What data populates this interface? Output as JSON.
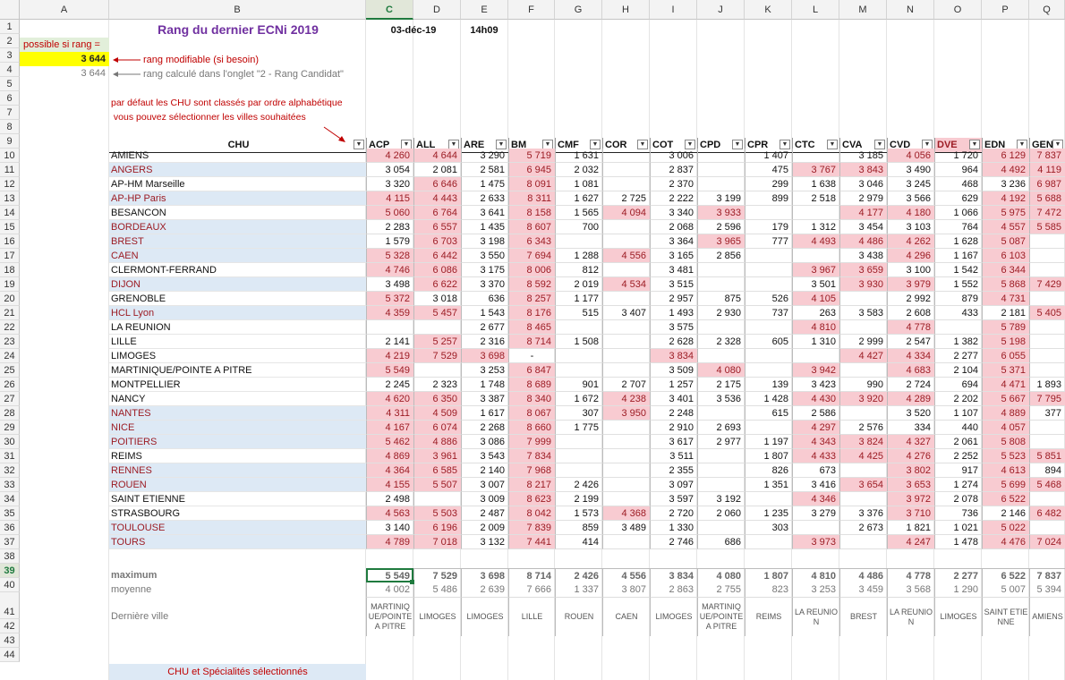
{
  "columns": [
    "A",
    "B",
    "C",
    "D",
    "E",
    "F",
    "G",
    "H",
    "I",
    "J",
    "K",
    "L",
    "M",
    "N",
    "O",
    "P",
    "Q"
  ],
  "selected_column": "C",
  "selected_row": "39",
  "row_numbers": [
    "1",
    "2",
    "3",
    "4",
    "5",
    "6",
    "7",
    "8",
    "9",
    "10",
    "11",
    "12",
    "13",
    "14",
    "15",
    "16",
    "17",
    "18",
    "19",
    "20",
    "21",
    "22",
    "23",
    "24",
    "25",
    "26",
    "27",
    "28",
    "29",
    "30",
    "31",
    "32",
    "33",
    "34",
    "35",
    "36",
    "37",
    "38",
    "39",
    "40",
    "41",
    "42",
    "43",
    "44"
  ],
  "header": {
    "title": "Rang du dernier ECNi 2019",
    "date": "03-déc-19",
    "time": "14h09"
  },
  "rank_panel": {
    "possible_label": "possible si rang =",
    "rank_value": "3 644",
    "rank_calc_value": "3 644",
    "note_modifiable": "rang modifiable (si besoin)",
    "note_calc": "rang calculé dans l'onglet \"2 - Rang Candidat\""
  },
  "instructions": [
    "par défaut les CHU sont classés par ordre alphabétique",
    " vous pouvez sélectionner les villes souhaitées"
  ],
  "colors": {
    "pink_fill": "#f8cbd1",
    "pink_text": "#9c1c24",
    "highlight_row": "#dde9f5",
    "title_purple": "#7030a0",
    "yellow": "#ffff00",
    "arrow_red": "#c00000"
  },
  "table": {
    "chu_header": "CHU",
    "specialties": [
      "ACP",
      "ALL",
      "ARE",
      "BM",
      "CMF",
      "COR",
      "COT",
      "CPD",
      "CPR",
      "CTC",
      "CVA",
      "CVD",
      "DVE",
      "EDN",
      "GEN"
    ],
    "rows": [
      {
        "chu": "AMIENS",
        "hl": false,
        "values": [
          "4 260",
          "4 644",
          "3 290",
          "5 719",
          "1 631",
          "",
          "3 006",
          "",
          "1 407",
          "",
          "3 185",
          "4 056",
          "1 720",
          "6 129",
          "7 837"
        ],
        "pink": [
          1,
          1,
          0,
          1,
          0,
          0,
          0,
          0,
          0,
          0,
          0,
          1,
          0,
          1,
          1
        ]
      },
      {
        "chu": "ANGERS",
        "hl": true,
        "values": [
          "3 054",
          "2 081",
          "2 581",
          "6 945",
          "2 032",
          "",
          "2 837",
          "",
          "475",
          "3 767",
          "3 843",
          "3 490",
          "964",
          "4 492",
          "4 119"
        ],
        "pink": [
          0,
          0,
          0,
          1,
          0,
          0,
          0,
          0,
          0,
          1,
          1,
          0,
          0,
          1,
          1
        ]
      },
      {
        "chu": "AP-HM Marseille",
        "hl": false,
        "values": [
          "3 320",
          "6 646",
          "1 475",
          "8 091",
          "1 081",
          "",
          "2 370",
          "",
          "299",
          "1 638",
          "3 046",
          "3 245",
          "468",
          "3 236",
          "6 987"
        ],
        "pink": [
          0,
          1,
          0,
          1,
          0,
          0,
          0,
          0,
          0,
          0,
          0,
          0,
          0,
          0,
          1
        ]
      },
      {
        "chu": "AP-HP Paris",
        "hl": true,
        "values": [
          "4 115",
          "4 443",
          "2 633",
          "8 311",
          "1 627",
          "2 725",
          "2 222",
          "3 199",
          "899",
          "2 518",
          "2 979",
          "3 566",
          "629",
          "4 192",
          "5 688"
        ],
        "pink": [
          1,
          1,
          0,
          1,
          0,
          0,
          0,
          0,
          0,
          0,
          0,
          0,
          0,
          1,
          1
        ]
      },
      {
        "chu": "BESANCON",
        "hl": false,
        "values": [
          "5 060",
          "6 764",
          "3 641",
          "8 158",
          "1 565",
          "4 094",
          "3 340",
          "3 933",
          "",
          "",
          "4 177",
          "4 180",
          "1 066",
          "5 975",
          "7 472"
        ],
        "pink": [
          1,
          1,
          0,
          1,
          0,
          1,
          0,
          1,
          0,
          0,
          1,
          1,
          0,
          1,
          1
        ]
      },
      {
        "chu": "BORDEAUX",
        "hl": true,
        "values": [
          "2 283",
          "6 557",
          "1 435",
          "8 607",
          "700",
          "",
          "2 068",
          "2 596",
          "179",
          "1 312",
          "3 454",
          "3 103",
          "764",
          "4 557",
          "5 585"
        ],
        "pink": [
          0,
          1,
          0,
          1,
          0,
          0,
          0,
          0,
          0,
          0,
          0,
          0,
          0,
          1,
          1
        ]
      },
      {
        "chu": "BREST",
        "hl": true,
        "values": [
          "1 579",
          "6 703",
          "3 198",
          "6 343",
          "",
          "",
          "3 364",
          "3 965",
          "777",
          "4 493",
          "4 486",
          "4 262",
          "1 628",
          "5 087",
          ""
        ],
        "pink": [
          0,
          1,
          0,
          1,
          0,
          0,
          0,
          1,
          0,
          1,
          1,
          1,
          0,
          1,
          0
        ]
      },
      {
        "chu": "CAEN",
        "hl": true,
        "values": [
          "5 328",
          "6 442",
          "3 550",
          "7 694",
          "1 288",
          "4 556",
          "3 165",
          "2 856",
          "",
          "",
          "3 438",
          "4 296",
          "1 167",
          "6 103",
          ""
        ],
        "pink": [
          1,
          1,
          0,
          1,
          0,
          1,
          0,
          0,
          0,
          0,
          0,
          1,
          0,
          1,
          0
        ]
      },
      {
        "chu": "CLERMONT-FERRAND",
        "hl": false,
        "values": [
          "4 746",
          "6 086",
          "3 175",
          "8 006",
          "812",
          "",
          "3 481",
          "",
          "",
          "3 967",
          "3 659",
          "3 100",
          "1 542",
          "6 344",
          ""
        ],
        "pink": [
          1,
          1,
          0,
          1,
          0,
          0,
          0,
          0,
          0,
          1,
          1,
          0,
          0,
          1,
          0
        ]
      },
      {
        "chu": "DIJON",
        "hl": true,
        "values": [
          "3 498",
          "6 622",
          "3 370",
          "8 592",
          "2 019",
          "4 534",
          "3 515",
          "",
          "",
          "3 501",
          "3 930",
          "3 979",
          "1 552",
          "5 868",
          "7 429"
        ],
        "pink": [
          0,
          1,
          0,
          1,
          0,
          1,
          0,
          0,
          0,
          0,
          1,
          1,
          0,
          1,
          1
        ]
      },
      {
        "chu": "GRENOBLE",
        "hl": false,
        "values": [
          "5 372",
          "3 018",
          "636",
          "8 257",
          "1 177",
          "",
          "2 957",
          "875",
          "526",
          "4 105",
          "",
          "2 992",
          "879",
          "4 731",
          ""
        ],
        "pink": [
          1,
          0,
          0,
          1,
          0,
          0,
          0,
          0,
          0,
          1,
          0,
          0,
          0,
          1,
          0
        ]
      },
      {
        "chu": "HCL Lyon",
        "hl": true,
        "values": [
          "4 359",
          "5 457",
          "1 543",
          "8 176",
          "515",
          "3 407",
          "1 493",
          "2 930",
          "737",
          "263",
          "3 583",
          "2 608",
          "433",
          "2 181",
          "5 405"
        ],
        "pink": [
          1,
          1,
          0,
          1,
          0,
          0,
          0,
          0,
          0,
          0,
          0,
          0,
          0,
          0,
          1
        ]
      },
      {
        "chu": "LA REUNION",
        "hl": false,
        "values": [
          "",
          "",
          "2 677",
          "8 465",
          "",
          "",
          "3 575",
          "",
          "",
          "4 810",
          "",
          "4 778",
          "",
          "5 789",
          ""
        ],
        "pink": [
          0,
          0,
          0,
          1,
          0,
          0,
          0,
          0,
          0,
          1,
          0,
          1,
          0,
          1,
          0
        ]
      },
      {
        "chu": "LILLE",
        "hl": false,
        "values": [
          "2 141",
          "5 257",
          "2 316",
          "8 714",
          "1 508",
          "",
          "2 628",
          "2 328",
          "605",
          "1 310",
          "2 999",
          "2 547",
          "1 382",
          "5 198",
          ""
        ],
        "pink": [
          0,
          1,
          0,
          1,
          0,
          0,
          0,
          0,
          0,
          0,
          0,
          0,
          0,
          1,
          0
        ]
      },
      {
        "chu": "LIMOGES",
        "hl": false,
        "values": [
          "4 219",
          "7 529",
          "3 698",
          "-",
          "",
          "",
          "3 834",
          "",
          "",
          "",
          "4 427",
          "4 334",
          "2 277",
          "6 055",
          ""
        ],
        "pink": [
          1,
          1,
          1,
          0,
          0,
          0,
          1,
          0,
          0,
          0,
          1,
          1,
          0,
          1,
          0
        ]
      },
      {
        "chu": "MARTINIQUE/POINTE A PITRE",
        "hl": false,
        "values": [
          "5 549",
          "",
          "3 253",
          "6 847",
          "",
          "",
          "3 509",
          "4 080",
          "",
          "3 942",
          "",
          "4 683",
          "2 104",
          "5 371",
          ""
        ],
        "pink": [
          1,
          0,
          0,
          1,
          0,
          0,
          0,
          1,
          0,
          1,
          0,
          1,
          0,
          1,
          0
        ]
      },
      {
        "chu": "MONTPELLIER",
        "hl": false,
        "values": [
          "2 245",
          "2 323",
          "1 748",
          "8 689",
          "901",
          "2 707",
          "1 257",
          "2 175",
          "139",
          "3 423",
          "990",
          "2 724",
          "694",
          "4 471",
          "1 893"
        ],
        "pink": [
          0,
          0,
          0,
          1,
          0,
          0,
          0,
          0,
          0,
          0,
          0,
          0,
          0,
          1,
          0
        ]
      },
      {
        "chu": "NANCY",
        "hl": false,
        "values": [
          "4 620",
          "6 350",
          "3 387",
          "8 340",
          "1 672",
          "4 238",
          "3 401",
          "3 536",
          "1 428",
          "4 430",
          "3 920",
          "4 289",
          "2 202",
          "5 667",
          "7 795"
        ],
        "pink": [
          1,
          1,
          0,
          1,
          0,
          1,
          0,
          0,
          0,
          1,
          1,
          1,
          0,
          1,
          1
        ]
      },
      {
        "chu": "NANTES",
        "hl": true,
        "values": [
          "4 311",
          "4 509",
          "1 617",
          "8 067",
          "307",
          "3 950",
          "2 248",
          "",
          "615",
          "2 586",
          "",
          "3 520",
          "1 107",
          "4 889",
          "377"
        ],
        "pink": [
          1,
          1,
          0,
          1,
          0,
          1,
          0,
          0,
          0,
          0,
          0,
          0,
          0,
          1,
          0
        ]
      },
      {
        "chu": "NICE",
        "hl": true,
        "values": [
          "4 167",
          "6 074",
          "2 268",
          "8 660",
          "1 775",
          "",
          "2 910",
          "2 693",
          "",
          "4 297",
          "2 576",
          "334",
          "440",
          "4 057",
          ""
        ],
        "pink": [
          1,
          1,
          0,
          1,
          0,
          0,
          0,
          0,
          0,
          1,
          0,
          0,
          0,
          1,
          0
        ]
      },
      {
        "chu": "POITIERS",
        "hl": true,
        "values": [
          "5 462",
          "4 886",
          "3 086",
          "7 999",
          "",
          "",
          "3 617",
          "2 977",
          "1 197",
          "4 343",
          "3 824",
          "4 327",
          "2 061",
          "5 808",
          ""
        ],
        "pink": [
          1,
          1,
          0,
          1,
          0,
          0,
          0,
          0,
          0,
          1,
          1,
          1,
          0,
          1,
          0
        ]
      },
      {
        "chu": "REIMS",
        "hl": false,
        "values": [
          "4 869",
          "3 961",
          "3 543",
          "7 834",
          "",
          "",
          "3 511",
          "",
          "1 807",
          "4 433",
          "4 425",
          "4 276",
          "2 252",
          "5 523",
          "5 851"
        ],
        "pink": [
          1,
          1,
          0,
          1,
          0,
          0,
          0,
          0,
          0,
          1,
          1,
          1,
          0,
          1,
          1
        ]
      },
      {
        "chu": "RENNES",
        "hl": true,
        "values": [
          "4 364",
          "6 585",
          "2 140",
          "7 968",
          "",
          "",
          "2 355",
          "",
          "826",
          "673",
          "",
          "3 802",
          "917",
          "4 613",
          "894"
        ],
        "pink": [
          1,
          1,
          0,
          1,
          0,
          0,
          0,
          0,
          0,
          0,
          0,
          1,
          0,
          1,
          0
        ]
      },
      {
        "chu": "ROUEN",
        "hl": true,
        "values": [
          "4 155",
          "5 507",
          "3 007",
          "8 217",
          "2 426",
          "",
          "3 097",
          "",
          "1 351",
          "3 416",
          "3 654",
          "3 653",
          "1 274",
          "5 699",
          "5 468"
        ],
        "pink": [
          1,
          1,
          0,
          1,
          0,
          0,
          0,
          0,
          0,
          0,
          1,
          1,
          0,
          1,
          1
        ]
      },
      {
        "chu": "SAINT ETIENNE",
        "hl": false,
        "values": [
          "2 498",
          "",
          "3 009",
          "8 623",
          "2 199",
          "",
          "3 597",
          "3 192",
          "",
          "4 346",
          "",
          "3 972",
          "2 078",
          "6 522",
          ""
        ],
        "pink": [
          0,
          0,
          0,
          1,
          0,
          0,
          0,
          0,
          0,
          1,
          0,
          1,
          0,
          1,
          0
        ]
      },
      {
        "chu": "STRASBOURG",
        "hl": false,
        "values": [
          "4 563",
          "5 503",
          "2 487",
          "8 042",
          "1 573",
          "4 368",
          "2 720",
          "2 060",
          "1 235",
          "3 279",
          "3 376",
          "3 710",
          "736",
          "2 146",
          "6 482"
        ],
        "pink": [
          1,
          1,
          0,
          1,
          0,
          1,
          0,
          0,
          0,
          0,
          0,
          1,
          0,
          0,
          1
        ]
      },
      {
        "chu": "TOULOUSE",
        "hl": true,
        "values": [
          "3 140",
          "6 196",
          "2 009",
          "7 839",
          "859",
          "3 489",
          "1 330",
          "",
          "303",
          "",
          "2 673",
          "1 821",
          "1 021",
          "5 022",
          ""
        ],
        "pink": [
          0,
          1,
          0,
          1,
          0,
          0,
          0,
          0,
          0,
          0,
          0,
          0,
          0,
          1,
          0
        ]
      },
      {
        "chu": "TOURS",
        "hl": true,
        "values": [
          "4 789",
          "7 018",
          "3 132",
          "7 441",
          "414",
          "",
          "2 746",
          "686",
          "",
          "3 973",
          "",
          "4 247",
          "1 478",
          "4 476",
          "7 024"
        ],
        "pink": [
          1,
          1,
          0,
          1,
          0,
          0,
          0,
          0,
          0,
          1,
          0,
          1,
          0,
          1,
          1
        ]
      }
    ],
    "maximum_label": "maximum",
    "maximum": [
      "5 549",
      "7 529",
      "3 698",
      "8 714",
      "2 426",
      "4 556",
      "3 834",
      "4 080",
      "1 807",
      "4 810",
      "4 486",
      "4 778",
      "2 277",
      "6 522",
      "7 837"
    ],
    "moyenne_label": "moyenne",
    "moyenne": [
      "4 002",
      "5 486",
      "2 639",
      "7 666",
      "1 337",
      "3 807",
      "2 863",
      "2 755",
      "823",
      "3 253",
      "3 459",
      "3 568",
      "1 290",
      "5 007",
      "5 394"
    ],
    "derniere_label": "Dernière ville",
    "derniere": [
      "MARTINIQ UE/POINTE A PITRE",
      "LIMOGES",
      "LIMOGES",
      "LILLE",
      "ROUEN",
      "CAEN",
      "LIMOGES",
      "MARTINIQ UE/POINTE A PITRE",
      "REIMS",
      "LA REUNION",
      "BREST",
      "LA REUNION",
      "LIMOGES",
      "SAINT ETIENNE",
      "AMIENS"
    ]
  },
  "footer": {
    "selected_label": "CHU et Spécialités sélectionnés"
  }
}
